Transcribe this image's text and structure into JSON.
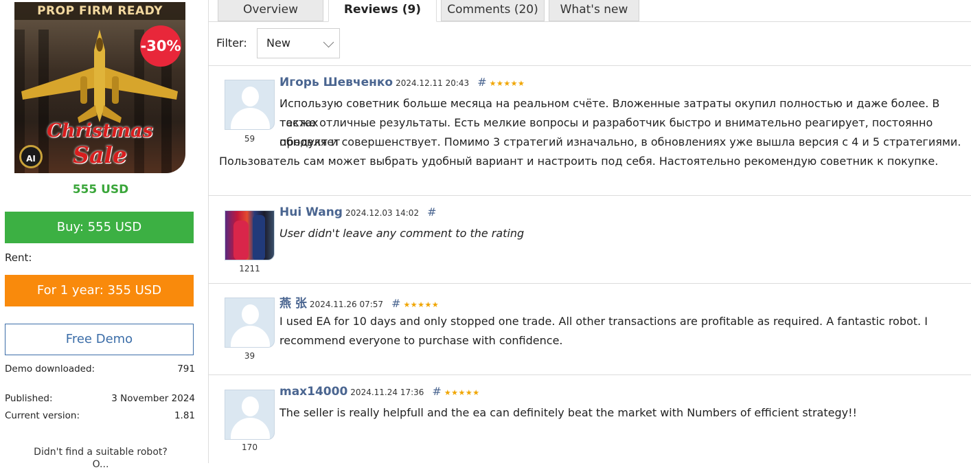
{
  "product": {
    "banner": "PROP FIRM READY",
    "discount": "-30%",
    "sale_line1": "Christmas",
    "sale_line2": "Sale",
    "badge": "AI",
    "price": "555 USD"
  },
  "buttons": {
    "buy": "Buy: 555 USD",
    "rent_label": "Rent:",
    "rent": "For 1 year: 355 USD",
    "demo": "Free Demo"
  },
  "stats": {
    "demo_downloaded_label": "Demo downloaded:",
    "demo_downloaded_value": "791",
    "published_label": "Published:",
    "published_value": "3 November 2024",
    "version_label": "Current version:",
    "version_value": "1.81"
  },
  "footer_prompt": "Didn't find a suitable robot?",
  "footer_prompt2": "O...",
  "tabs": [
    {
      "label": "Overview"
    },
    {
      "label": "Reviews (9)"
    },
    {
      "label": "Comments (20)"
    },
    {
      "label": "What's new"
    }
  ],
  "filter": {
    "label": "Filter:",
    "selected": "New"
  },
  "reviews": [
    {
      "author": "Игорь Шевченко",
      "date": "2024.12.11 20:43",
      "hash": "#",
      "stars": "★★★★★",
      "rating": 5,
      "rank": "59",
      "text_line1": "Использую советник больше месяца на реальном счёте. Вложенные затраты окупил полностью и даже более. В тестах",
      "text_line2": "также отличные результаты. Есть мелкие вопросы и разработчик быстро и внимательно реагирует, постоянно обновляет",
      "text_line3": "продукт и совершенствует. Помимо 3 стратегий изначально, в обновлениях уже вышла версия с 4 и 5 стратегиями.",
      "text_line4": "Пользователь сам может выбрать удобный вариант и настроить под себя. Настоятельно рекомендую советник к покупке."
    },
    {
      "author": "Hui Wang",
      "date": "2024.12.03 14:02",
      "hash": "#",
      "rank": "1211",
      "text_line1": "User didn't leave any comment to the rating"
    },
    {
      "author": "燕 张",
      "date": "2024.11.26 07:57",
      "hash": "#",
      "stars": "★★★★★",
      "rating": 5,
      "rank": "39",
      "text_line1": "I used EA for 10 days and only stopped one trade. All other transactions are profitable as required. A fantastic robot. I",
      "text_line2": "recommend everyone to purchase with confidence."
    },
    {
      "author": "max14000",
      "date": "2024.11.24 17:36",
      "hash": "#",
      "stars": "★★★★★",
      "rating": 5,
      "rank": "170",
      "text_line1": "The seller is really helpfull and the ea can definitely beat the market with Numbers of efficient strategy!!"
    }
  ]
}
